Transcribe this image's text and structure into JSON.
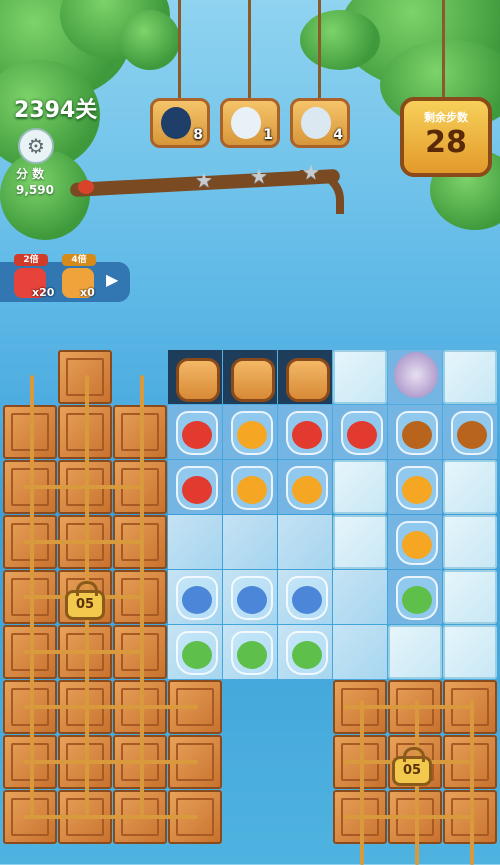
{
  "hud": {
    "level_text": "2394关",
    "score_label": "分 数",
    "score_value": "9,590",
    "moves_label": "剩余步数",
    "moves_value": "28",
    "stars": [
      "star",
      "star",
      "star"
    ],
    "settings_icon": "gear-icon"
  },
  "goals": [
    {
      "animal": "penguin",
      "count": "8",
      "color": "#1f3f6a"
    },
    {
      "animal": "polar-bear",
      "count": "1",
      "color": "#e8f0f8"
    },
    {
      "animal": "seal",
      "count": "4",
      "color": "#dbe8f2"
    }
  ],
  "boosters": [
    {
      "multiplier": "2倍",
      "quantity": "x20",
      "color": "#e8433a"
    },
    {
      "multiplier": "4倍",
      "quantity": "x0",
      "color": "#f0a33a"
    }
  ],
  "locks": [
    {
      "label": "05"
    },
    {
      "label": "05"
    }
  ],
  "colors": {
    "red_creature": "#e23a2e",
    "orange_creature": "#f5a623",
    "brown_creature": "#b9641c",
    "green_creature": "#5ec04a",
    "blue_creature": "#4c86d8"
  }
}
